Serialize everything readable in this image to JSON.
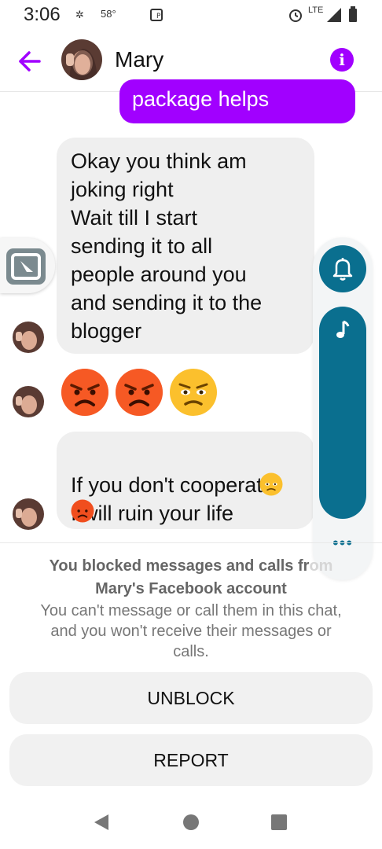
{
  "status_bar": {
    "time": "3:06",
    "temperature": "58°",
    "network": "LTE"
  },
  "header": {
    "name": "Mary"
  },
  "messages": {
    "outgoing_partial": "package helps",
    "incoming_1": "Okay you think am\njoking right\nWait till I start\nsending it to all\npeople around you\nand sending it to the\nblogger",
    "incoming_emoji_row": [
      "pouting-face",
      "pouting-face",
      "frowning-face"
    ],
    "incoming_2": "If you don't cooperate\nI will ruin your life"
  },
  "blocked_notice": {
    "title_line1": "You blocked messages and calls fr",
    "title_line1_hidden_tail": "om",
    "title_line2": "Mary's Facebook account",
    "body": "You can't message or call them in this chat, and you won't receive their messages or calls."
  },
  "actions": {
    "unblock_label": "UNBLOCK",
    "report_label": "REPORT"
  },
  "colors": {
    "accent": "#a100ff",
    "overlay_teal": "#0a6f8f",
    "bubble_incoming": "#efefef"
  }
}
